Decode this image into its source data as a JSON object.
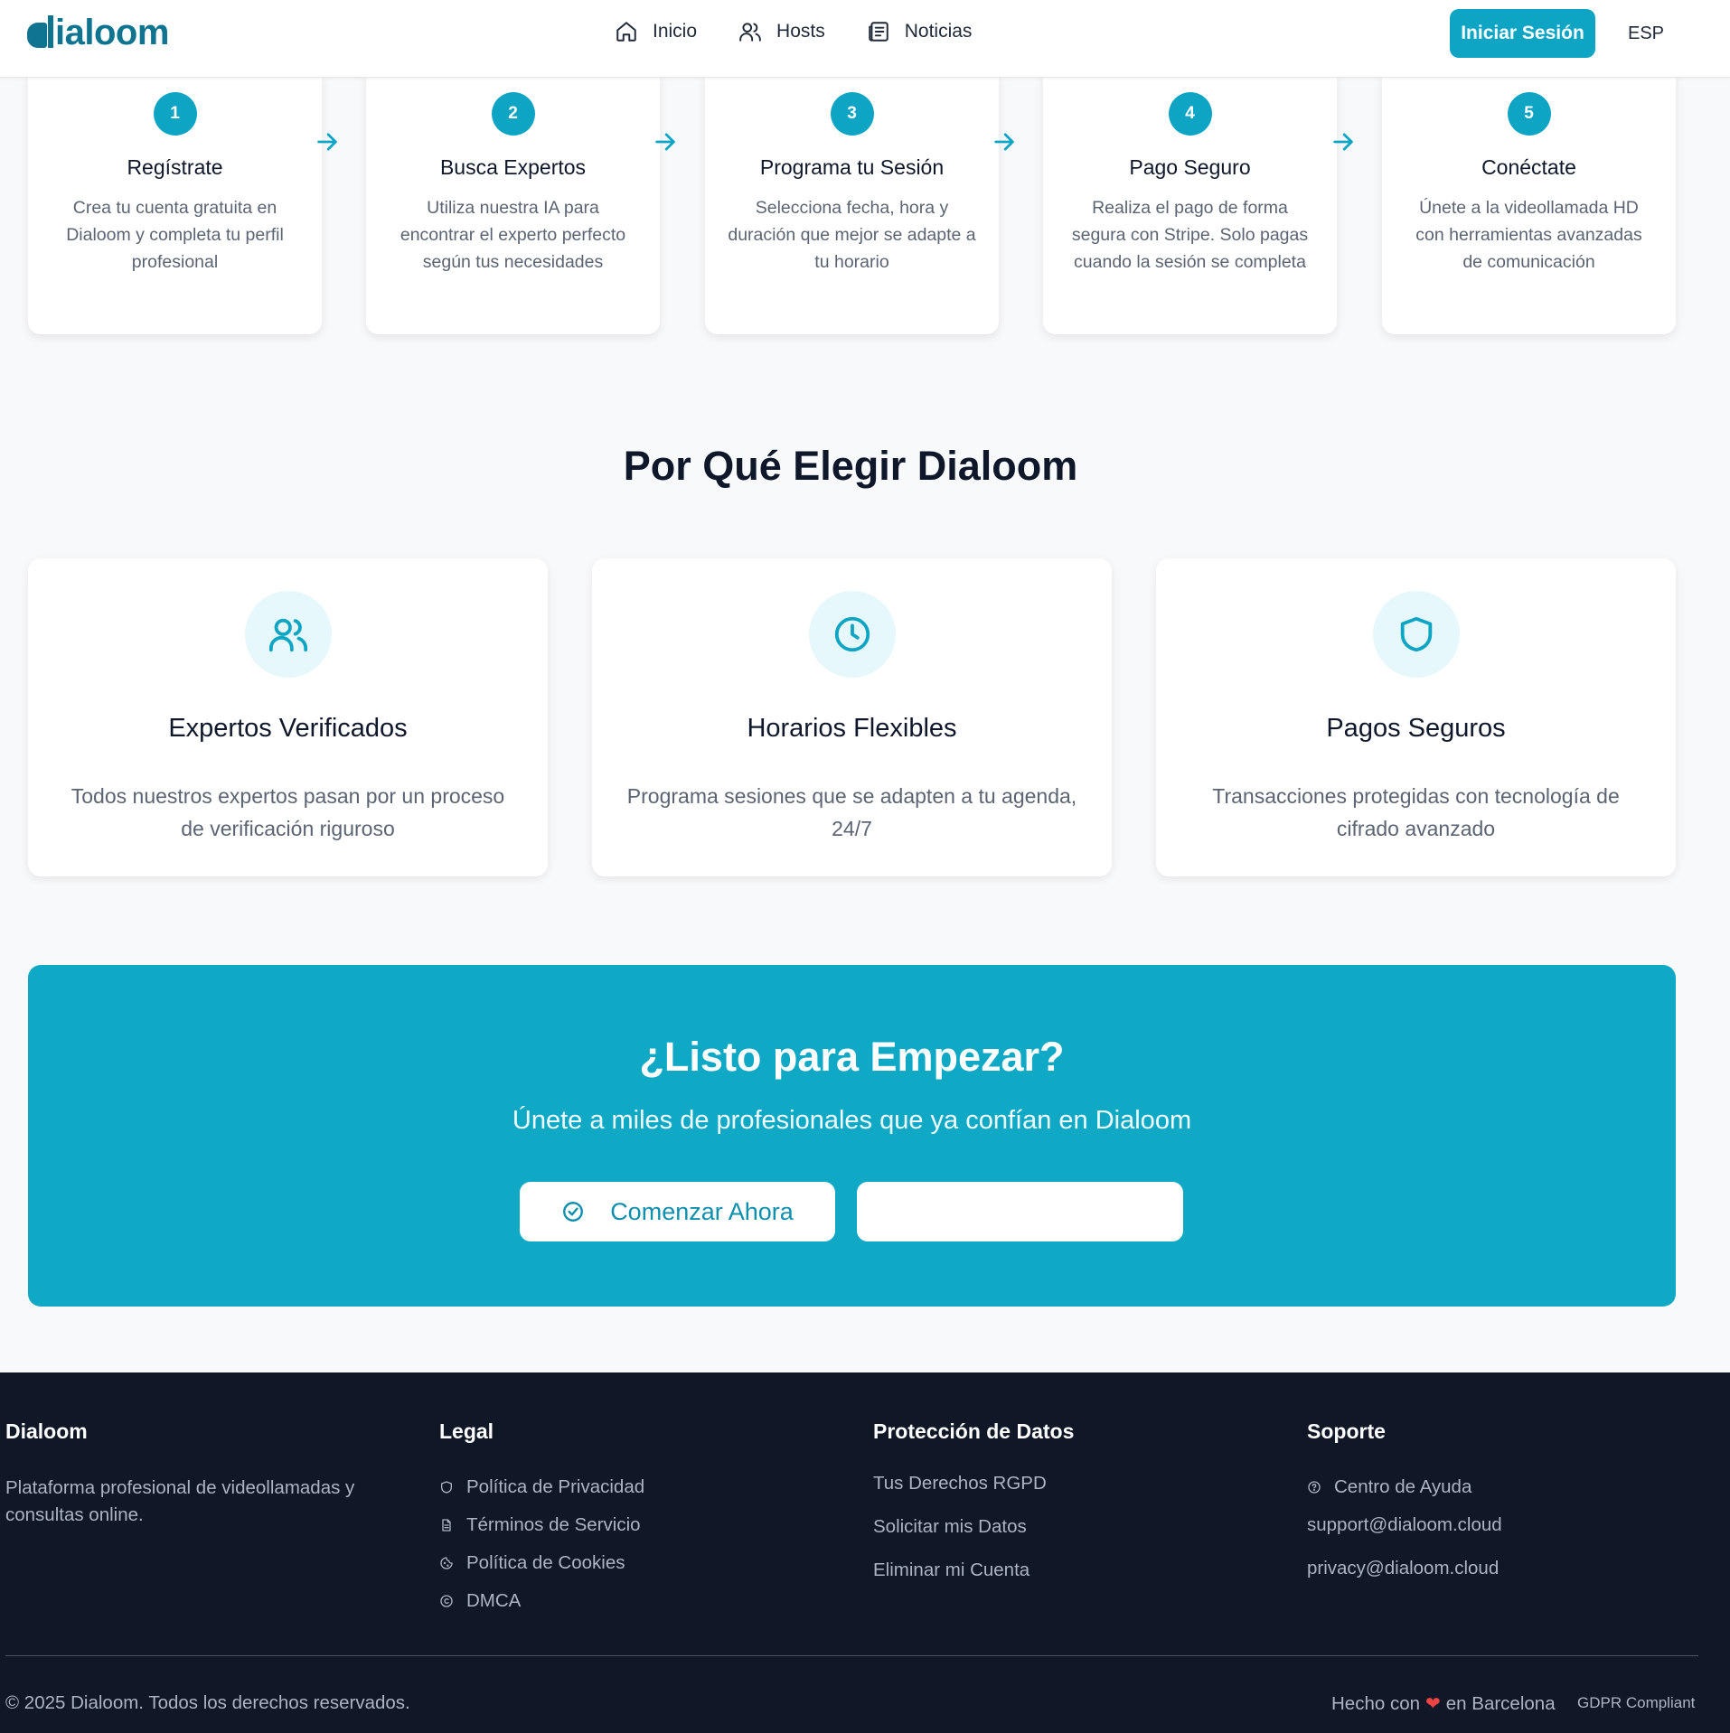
{
  "brand": {
    "logo_text": "ialoom",
    "accent": "#0ea5c4"
  },
  "nav": {
    "items": [
      {
        "label": "Inicio",
        "icon": "home-icon"
      },
      {
        "label": "Hosts",
        "icon": "users-icon"
      },
      {
        "label": "Noticias",
        "icon": "newspaper-icon"
      }
    ],
    "login_label": "Iniciar Sesión",
    "language": "ESP"
  },
  "steps": [
    {
      "number": "1",
      "title": "Regístrate",
      "description": "Crea tu cuenta gratuita en Dialoom y completa tu perfil profesional"
    },
    {
      "number": "2",
      "title": "Busca Expertos",
      "description": "Utiliza nuestra IA para encontrar el experto perfecto según tus necesidades"
    },
    {
      "number": "3",
      "title": "Programa tu Sesión",
      "description": "Selecciona fecha, hora y duración que mejor se adapte a tu horario"
    },
    {
      "number": "4",
      "title": "Pago Seguro",
      "description": "Realiza el pago de forma segura con Stripe. Solo pagas cuando la sesión se completa"
    },
    {
      "number": "5",
      "title": "Conéctate",
      "description": "Únete a la videollamada HD con herramientas avanzadas de comunicación"
    }
  ],
  "why": {
    "title": "Por Qué Elegir Dialoom",
    "features": [
      {
        "icon": "users-icon",
        "title": "Expertos Verificados",
        "description": "Todos nuestros expertos pasan por un proceso de verificación riguroso"
      },
      {
        "icon": "clock-icon",
        "title": "Horarios Flexibles",
        "description": "Programa sesiones que se adapten a tu agenda, 24/7"
      },
      {
        "icon": "shield-icon",
        "title": "Pagos Seguros",
        "description": "Transacciones protegidas con tecnología de cifrado avanzado"
      }
    ]
  },
  "cta": {
    "title": "¿Listo para Empezar?",
    "subtitle": "Únete a miles de profesionales que ya confían en Dialoom",
    "primary_label": "Comenzar Ahora",
    "secondary_label": ""
  },
  "footer": {
    "about": {
      "title": "Dialoom",
      "text": "Plataforma profesional de videollamadas y consultas online."
    },
    "legal": {
      "title": "Legal",
      "links": [
        {
          "label": "Política de Privacidad",
          "icon": "shield-icon"
        },
        {
          "label": "Términos de Servicio",
          "icon": "document-icon"
        },
        {
          "label": "Política de Cookies",
          "icon": "cookie-icon"
        },
        {
          "label": "DMCA",
          "icon": "copyright-icon"
        }
      ]
    },
    "data": {
      "title": "Protección de Datos",
      "links": [
        "Tus Derechos RGPD",
        "Solicitar mis Datos",
        "Eliminar mi Cuenta"
      ]
    },
    "support": {
      "title": "Soporte",
      "help_label": "Centro de Ayuda",
      "email_support": "support@dialoom.cloud",
      "email_privacy": "privacy@dialoom.cloud"
    },
    "copyright": "© 2025 Dialoom. Todos los derechos reservados.",
    "made_prefix": "Hecho con",
    "made_suffix": "en Barcelona",
    "gdpr": "GDPR Compliant"
  }
}
